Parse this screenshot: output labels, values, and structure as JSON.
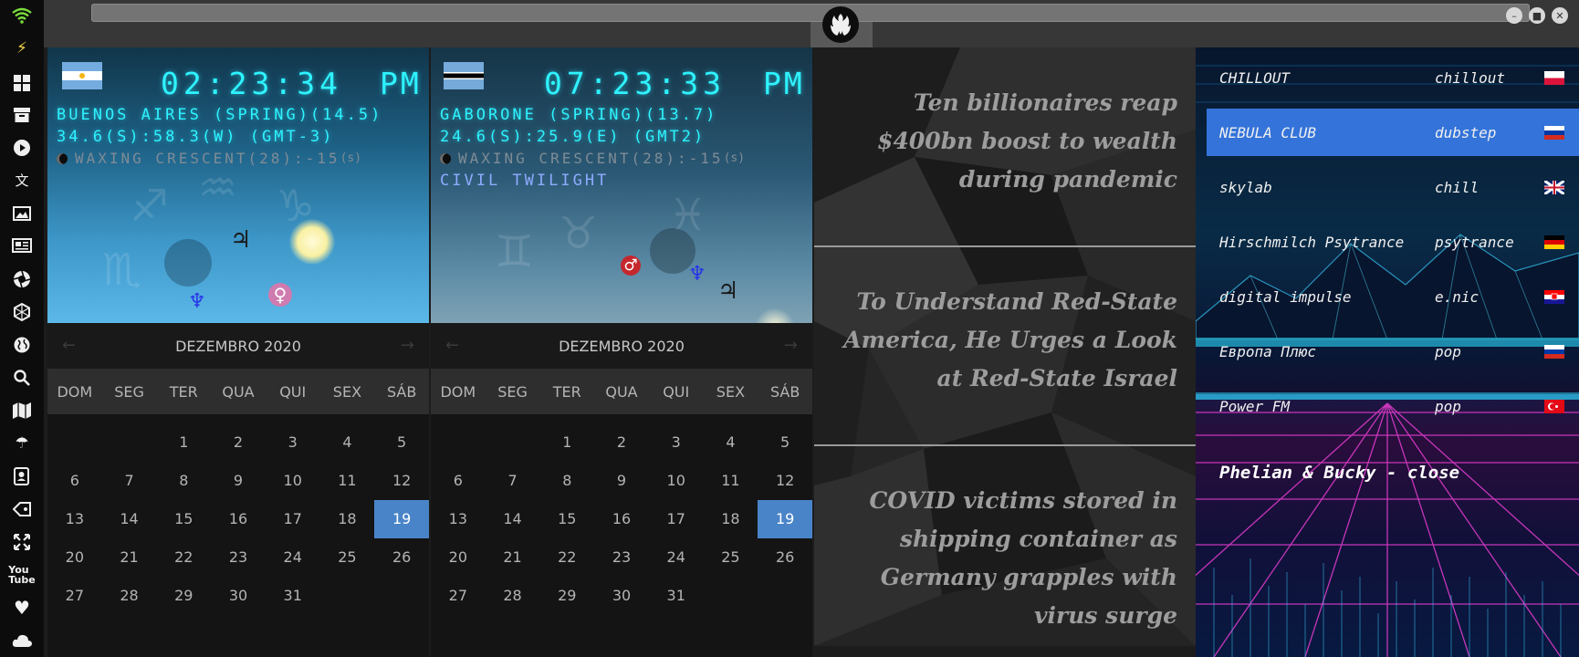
{
  "window": {
    "logo": "rebel-alliance-logo",
    "minimize": "–",
    "maximize": "■",
    "close": "✕"
  },
  "sidebar": {
    "icons": [
      "wifi-icon",
      "lightning-icon",
      "windows-icon",
      "archive-icon",
      "play-icon",
      "translate-icon",
      "image-icon",
      "newspaper-icon",
      "aperture-icon",
      "hexagon-icon",
      "globe-icon",
      "search-icon",
      "map-icon",
      "umbrella-icon",
      "contacts-icon",
      "tag-icon",
      "fullscreen-icon",
      "youtube-icon",
      "heart-icon",
      "cloud-icon"
    ]
  },
  "clocks": [
    {
      "time": "02:23:34",
      "ampm": "PM",
      "location": "BUENOS AIRES (SPRING)(14.5)",
      "coords": "34.6(S):58.3(W) (GMT-3)",
      "moon": "WAXING CRESCENT(28):-15",
      "moon_unit": "(s)",
      "twilight": "",
      "flag": "argentina-flag",
      "planets": {
        "jupiter": "♃",
        "neptune": "♆",
        "venus": "♀"
      }
    },
    {
      "time": "07:23:33",
      "ampm": "PM",
      "location": "GABORONE (SPRING)(13.7)",
      "coords": "24.6(S):25.9(E) (GMT2)",
      "moon": "WAXING CRESCENT(28):-15",
      "moon_unit": "(s)",
      "twilight": "CIVIL TWILIGHT",
      "flag": "botswana-flag",
      "planets": {
        "mars": "♂",
        "neptune": "♆",
        "jupiter": "♃"
      }
    }
  ],
  "calendar": {
    "month": "DEZEMBRO 2020",
    "prev": "←",
    "next": "→",
    "weekdays": [
      "DOM",
      "SEG",
      "TER",
      "QUA",
      "QUI",
      "SEX",
      "SÁB"
    ],
    "days": [
      "",
      "",
      "1",
      "2",
      "3",
      "4",
      "5",
      "6",
      "7",
      "8",
      "9",
      "10",
      "11",
      "12",
      "13",
      "14",
      "15",
      "16",
      "17",
      "18",
      "19",
      "20",
      "21",
      "22",
      "23",
      "24",
      "25",
      "26",
      "27",
      "28",
      "29",
      "30",
      "31"
    ],
    "selected": "19"
  },
  "news": {
    "headlines": [
      "Ten billionaires reap $400bn boost to wealth during pandemic",
      "To Understand Red-State America, He Urges a Look at Red-State Israel",
      "COVID victims stored in shipping container as Germany grapples with virus surge"
    ]
  },
  "radio": {
    "stations": [
      {
        "name": "CHILLOUT",
        "genre": "chillout",
        "flag": "poland-flag"
      },
      {
        "name": "NEBULA CLUB",
        "genre": "dubstep",
        "flag": "russia-flag"
      },
      {
        "name": "skylab",
        "genre": "chill",
        "flag": "uk-flag"
      },
      {
        "name": "Hirschmilch Psytrance",
        "genre": "psytrance",
        "flag": "germany-flag"
      },
      {
        "name": "digital impulse",
        "genre": "e.nic",
        "flag": "croatia-flag"
      },
      {
        "name": "Европа Плюс",
        "genre": "pop",
        "flag": "russia-flag"
      },
      {
        "name": "Power FM",
        "genre": "pop",
        "flag": "turkey-flag"
      }
    ],
    "now_playing": "Phelian & Bucky - close"
  },
  "colors": {
    "accent": "#4a84c8",
    "led": "#2ef3ff",
    "selected_station": "#3a80f0"
  }
}
